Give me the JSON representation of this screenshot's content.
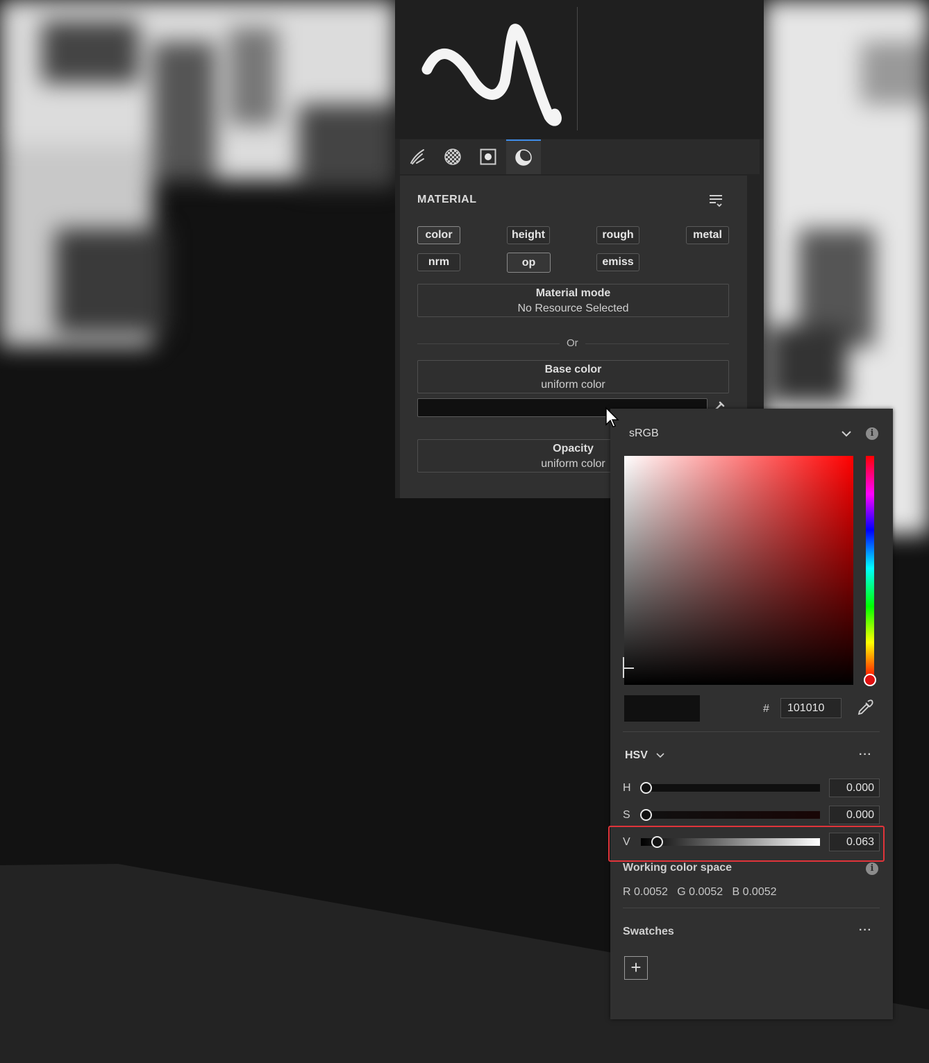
{
  "brush_panel": {
    "tabs": [
      {
        "icon": "brush-stroke-icon"
      },
      {
        "icon": "checker-texture-icon"
      },
      {
        "icon": "alpha-stencil-icon"
      },
      {
        "icon": "material-sphere-icon",
        "active": true
      }
    ],
    "material": {
      "title": "MATERIAL",
      "menu_icon": "list-settings-icon",
      "channels": [
        {
          "label": "color",
          "active": true
        },
        {
          "label": "height",
          "active": false
        },
        {
          "label": "rough",
          "active": false
        },
        {
          "label": "metal",
          "active": false
        },
        {
          "label": "nrm",
          "active": false
        },
        {
          "label": "op",
          "active": true
        },
        {
          "label": "emiss",
          "active": false
        }
      ],
      "material_mode": {
        "title": "Material mode",
        "value": "No Resource Selected"
      },
      "or_text": "Or",
      "base_color": {
        "title": "Base color",
        "value": "uniform color",
        "swatch": "#101010"
      },
      "opacity": {
        "title": "Opacity",
        "value": "uniform color"
      }
    }
  },
  "color_picker": {
    "color_space": "sRGB",
    "hue_color": "#ff0000",
    "hex_prefix": "#",
    "hex_value": "101010",
    "preview_color": "#101010",
    "mode_label": "HSV",
    "more_icon_label": "···",
    "sliders": [
      {
        "label": "H",
        "value": "0.000",
        "fraction": 0.0
      },
      {
        "label": "S",
        "value": "0.000",
        "fraction": 0.0
      },
      {
        "label": "V",
        "value": "0.063",
        "fraction": 0.063,
        "highlighted": true
      }
    ],
    "working_color_space": {
      "title": "Working color space",
      "r": "R 0.0052",
      "g": "G 0.0052",
      "b": "B 0.0052"
    },
    "swatches": {
      "title": "Swatches",
      "add_label": "+"
    },
    "accent_color": "#3f8ce8",
    "highlight_color": "#e0343a"
  }
}
